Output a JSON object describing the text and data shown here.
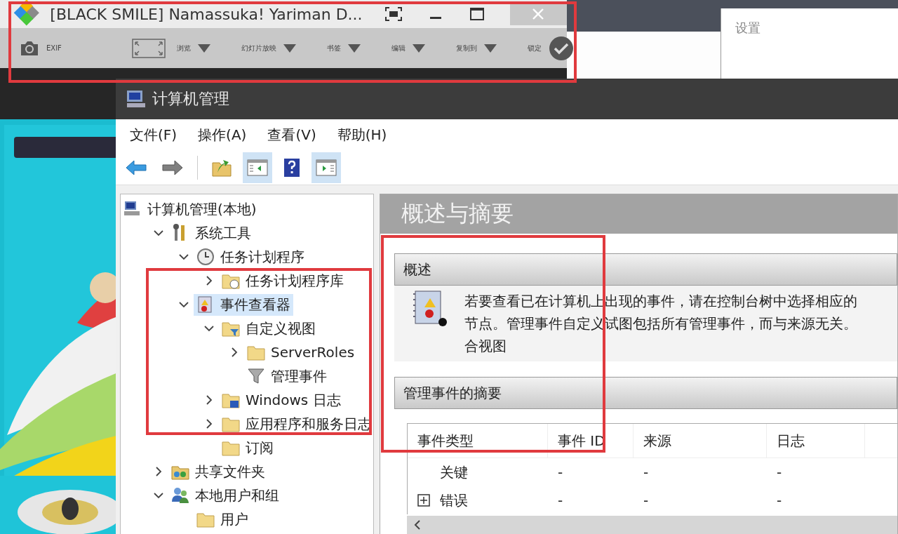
{
  "image_viewer": {
    "title": "[BLACK SMILE] Namassuka! Yariman D...",
    "toolbar": [
      {
        "kind": "camera",
        "label": "EXIF"
      },
      {
        "kind": "fit-menu",
        "label": "浏览"
      },
      {
        "kind": "menu",
        "label": "幻灯片放映"
      },
      {
        "kind": "menu",
        "label": "书签"
      },
      {
        "kind": "menu",
        "label": "编辑"
      },
      {
        "kind": "menu",
        "label": "复制到"
      },
      {
        "kind": "check",
        "label": "锁定"
      }
    ]
  },
  "settings_panel": {
    "title": "设置"
  },
  "computer_management": {
    "title": "计算机管理",
    "menu": [
      "文件(F)",
      "操作(A)",
      "查看(V)",
      "帮助(H)"
    ],
    "toolbar": [
      {
        "kind": "back",
        "pressed": false
      },
      {
        "kind": "forward",
        "pressed": false
      },
      {
        "kind": "up",
        "pressed": false
      },
      {
        "kind": "tree",
        "pressed": true
      },
      {
        "kind": "help",
        "pressed": false
      },
      {
        "kind": "action",
        "pressed": true
      }
    ],
    "tree": [
      {
        "label": "计算机管理(本地)",
        "kind": "computer",
        "selected": false,
        "children": [
          {
            "label": "系统工具",
            "kind": "tools",
            "expanded": true,
            "selected": false,
            "children": [
              {
                "label": "任务计划程序",
                "kind": "clock",
                "expanded": true,
                "selected": false,
                "children": [
                  {
                    "label": "任务计划程序库",
                    "kind": "clock-folder",
                    "expanded": false,
                    "selected": false
                  }
                ]
              },
              {
                "label": "事件查看器",
                "kind": "viewer",
                "expanded": true,
                "selected": true,
                "children": [
                  {
                    "label": "自定义视图",
                    "kind": "filter-folder",
                    "expanded": true,
                    "selected": false,
                    "children": [
                      {
                        "label": "ServerRoles",
                        "kind": "folder",
                        "expanded": false,
                        "selected": false
                      },
                      {
                        "label": "管理事件",
                        "kind": "filter",
                        "selected": false
                      }
                    ]
                  },
                  {
                    "label": "Windows 日志",
                    "kind": "log-folder",
                    "expanded": false,
                    "selected": false
                  },
                  {
                    "label": "应用程序和服务日志",
                    "kind": "folder",
                    "expanded": false,
                    "selected": false
                  },
                  {
                    "label": "订阅",
                    "kind": "folder",
                    "selected": false
                  }
                ]
              }
            ]
          },
          {
            "label": "共享文件夹",
            "kind": "share",
            "expanded": false,
            "selected": false
          },
          {
            "label": "本地用户和组",
            "kind": "users",
            "expanded": true,
            "selected": false,
            "children": [
              {
                "label": "用户",
                "kind": "folder",
                "selected": false
              }
            ]
          }
        ]
      }
    ],
    "content": {
      "heading": "概述与摘要",
      "overview": {
        "title": "概述",
        "lines": [
          "若要查看已在计算机上出现的事件，请在控制台树中选择相应的",
          "节点。管理事件自定义试图包括所有管理事件，而与来源无关。",
          "合视图"
        ]
      },
      "summary": {
        "title": "管理事件的摘要",
        "columns": [
          "事件类型",
          "事件 ID",
          "来源",
          "日志"
        ],
        "rows": [
          {
            "kind": "plain",
            "cells": [
              "关键",
              "-",
              "-",
              "-"
            ]
          },
          {
            "kind": "group",
            "cells": [
              "错误",
              "-",
              "-",
              "-"
            ]
          }
        ]
      }
    }
  }
}
